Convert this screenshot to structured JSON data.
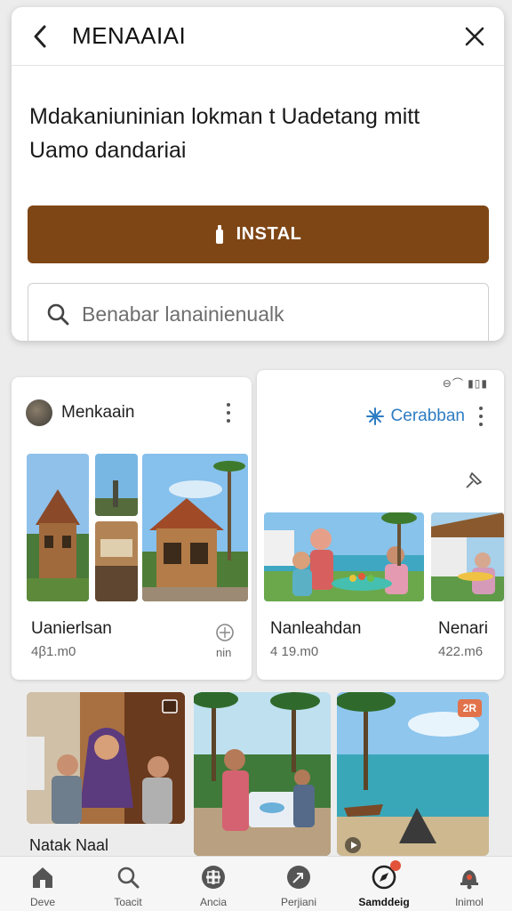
{
  "header": {
    "title": "MENAAIAI"
  },
  "description": {
    "line1": "Mdakaniuninian lokman t Uadetang mitt",
    "line2": "Uamo dandariai"
  },
  "install_button": {
    "label": "INSTAL"
  },
  "search": {
    "placeholder": "Benabar lanainienualk"
  },
  "status_bar": {
    "text": "⊖⌒ ▮▯▮"
  },
  "cards": [
    {
      "name": "Menkaain",
      "caption_title": "Uanierlsan",
      "caption_sub": "4β1.m0",
      "side_label": "nin"
    },
    {
      "name": "Cerabban",
      "caption_title": "Nanleahdan",
      "caption_sub": "4 19.m0",
      "caption_title_2": "Nenari",
      "caption_sub_2": "422.m6"
    }
  ],
  "bottom_row": {
    "caption": "Natak Naal",
    "badge_label": "2R"
  },
  "nav": [
    {
      "label": "Deve",
      "icon": "home-icon"
    },
    {
      "label": "Toacit",
      "icon": "search-icon"
    },
    {
      "label": "Ancia",
      "icon": "grid-icon"
    },
    {
      "label": "Perjiani",
      "icon": "feather-icon"
    },
    {
      "label": "Samddeig",
      "icon": "compass-icon"
    },
    {
      "label": "lnimol",
      "icon": "bell-icon"
    }
  ],
  "colors": {
    "install": "#7f4615",
    "accent_blue": "#2e7cc3",
    "badge": "#e2533a"
  }
}
